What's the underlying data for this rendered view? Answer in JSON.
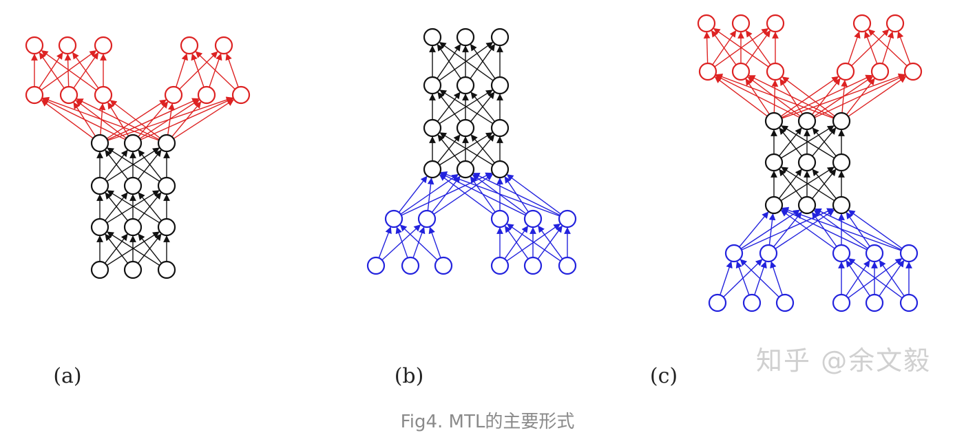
{
  "caption": "Fig4. MTL的主要形式",
  "watermark": "知乎 @余文毅",
  "colors": {
    "shared": "#111111",
    "task_output": "#dd2222",
    "task_input": "#2222dd"
  },
  "panels": [
    {
      "id": "a",
      "label": "(a)",
      "structure": "shared trunk with two task-specific output branches"
    },
    {
      "id": "b",
      "label": "(b)",
      "structure": "two task-specific input branches feeding a shared trunk"
    },
    {
      "id": "c",
      "label": "(c)",
      "structure": "task-specific input branches, shared trunk, task-specific output branches"
    }
  ]
}
